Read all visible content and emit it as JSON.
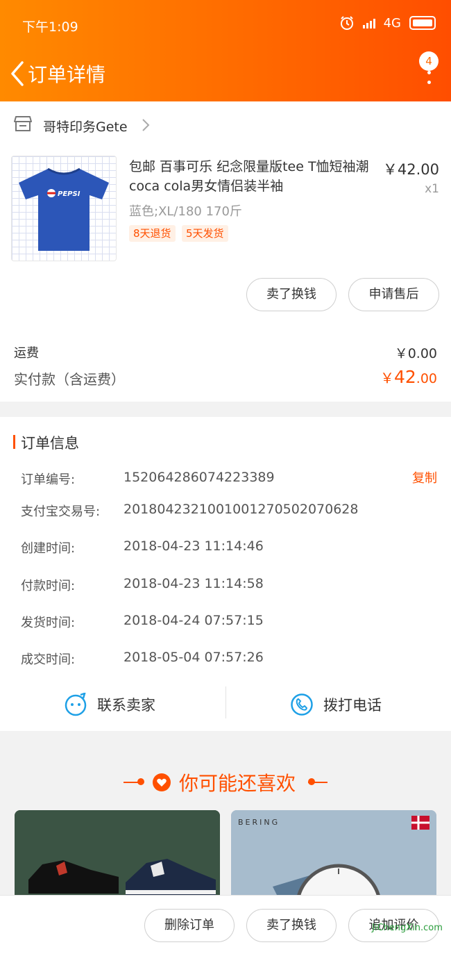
{
  "status_bar": {
    "time": "下午1:09",
    "network": "4G"
  },
  "header": {
    "title": "订单详情",
    "badge_count": "4"
  },
  "shop": {
    "name": "哥特印务Gete"
  },
  "product": {
    "title": "包邮 百事可乐 纪念限量版tee T恤短袖潮coca cola男女情侣装半袖",
    "image_text": "PEPSI",
    "price": "￥42.00",
    "quantity": "x1",
    "sku": "蓝色;XL/180 170斤",
    "tags": [
      "8天退货",
      "5天发货"
    ],
    "actions": [
      "卖了换钱",
      "申请售后"
    ]
  },
  "costs": {
    "shipping_label": "运费",
    "shipping_value": "￥0.00",
    "total_label": "实付款（含运费）",
    "total_currency": "￥",
    "total_int": "42",
    "total_dec": ".00"
  },
  "order_info": {
    "title": "订单信息",
    "copy_label": "复制",
    "rows": [
      {
        "label": "订单编号:",
        "value": "152064286074223389"
      },
      {
        "label": "支付宝交易号:",
        "value": "2018042321001001270502070628"
      },
      {
        "label": "创建时间:",
        "value": "2018-04-23 11:14:46"
      },
      {
        "label": "付款时间:",
        "value": "2018-04-23 11:14:58"
      },
      {
        "label": "发货时间:",
        "value": "2018-04-24 07:57:15"
      },
      {
        "label": "成交时间:",
        "value": "2018-05-04 07:57:26"
      }
    ]
  },
  "contact": {
    "seller": "联系卖家",
    "phone": "拨打电话"
  },
  "recommend": {
    "title": "你可能还喜欢",
    "brand_text": "BERING"
  },
  "bottom_actions": [
    "删除订单",
    "卖了换钱",
    "追加评价"
  ],
  "watermark": "JiChengXin.com",
  "colors": {
    "accent": "#ff5000",
    "header_start": "#ff8a00",
    "header_end": "#ff4e00",
    "contact_icon": "#1ea0e6"
  }
}
